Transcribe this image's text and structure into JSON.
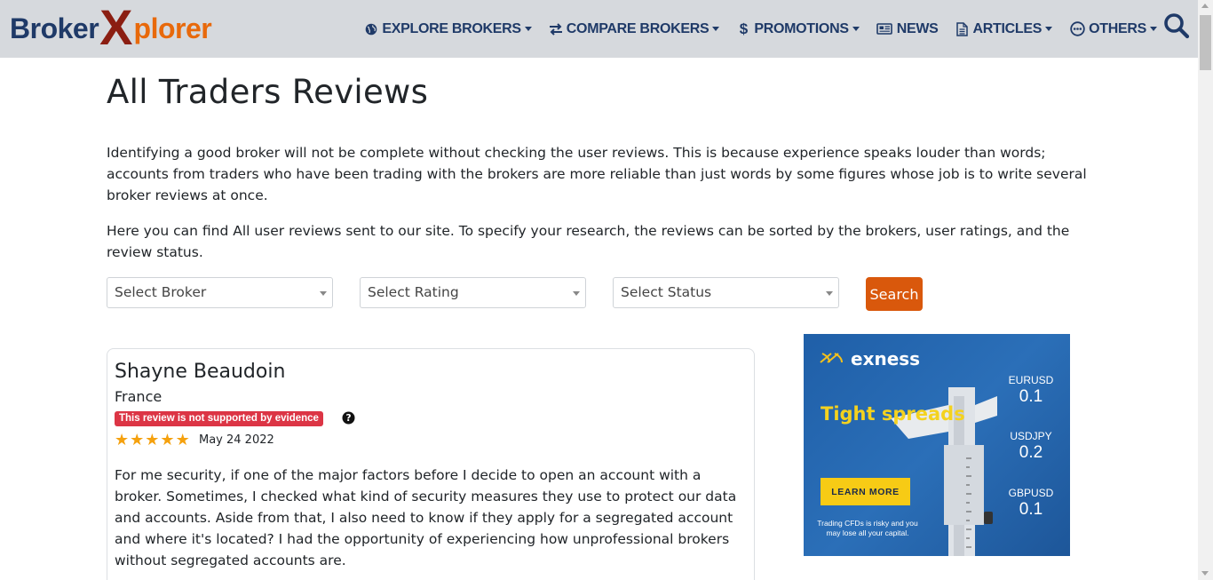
{
  "header": {
    "logo": {
      "part1": "Broker",
      "part2": "X",
      "part3": "plorer"
    },
    "nav": [
      {
        "label": "EXPLORE BROKERS",
        "icon": "globe-icon",
        "has_caret": true
      },
      {
        "label": "COMPARE BROKERS",
        "icon": "exchange-icon",
        "has_caret": true
      },
      {
        "label": "PROMOTIONS",
        "icon": "dollar-icon",
        "has_caret": true
      },
      {
        "label": "NEWS",
        "icon": "newspaper-icon",
        "has_caret": false
      },
      {
        "label": "ARTICLES",
        "icon": "document-icon",
        "has_caret": true
      },
      {
        "label": "OTHERS",
        "icon": "ellipsis-circle-icon",
        "has_caret": true
      }
    ],
    "search_icon": "search-icon"
  },
  "page": {
    "title": "All Traders Reviews",
    "intro_p1": "Identifying a good broker will not be complete without checking the user reviews. This is because experience speaks louder than words; accounts from traders who have been trading with the brokers are more reliable than just words by some figures whose job is to write several broker reviews at once.",
    "intro_p2": "Here you can find All user reviews sent to our site. To specify your research, the reviews can be sorted by the brokers, user ratings, and the review status."
  },
  "filters": {
    "broker": "Select Broker",
    "rating": "Select Rating",
    "status": "Select Status",
    "search_label": "Search"
  },
  "review": {
    "name": "Shayne Beaudoin",
    "country": "France",
    "badge": "This review is not supported by evidence",
    "rating": 5,
    "date": "May 24 2022",
    "text": "For me security, if one of the major factors before I decide to open an account with a broker. Sometimes, I checked what kind of security measures they use to protect our data and accounts. Aside from that, I also need to know if they apply for a segregated account and where it's located? I had the opportunity of experiencing how unprofessional brokers without segregated accounts are."
  },
  "ad": {
    "brand": "exness",
    "headline": "Tight spreads",
    "cta": "LEARN MORE",
    "risk_text": "Trading CFDs is risky and you may lose all your capital.",
    "quotes": [
      {
        "pair": "EURUSD",
        "value": "0.1"
      },
      {
        "pair": "USDJPY",
        "value": "0.2"
      },
      {
        "pair": "GBPUSD",
        "value": "0.1"
      }
    ],
    "colors": {
      "background": "#2266b0",
      "accent": "#f4d21f"
    }
  },
  "colors": {
    "brand_blue": "#1f3a68",
    "brand_orange": "#e8690b",
    "brand_red": "#8b1e12",
    "search_button": "#d9580c",
    "badge_red": "#dc3545",
    "star": "#f5a10e",
    "header_bg": "#d6d9dd"
  }
}
